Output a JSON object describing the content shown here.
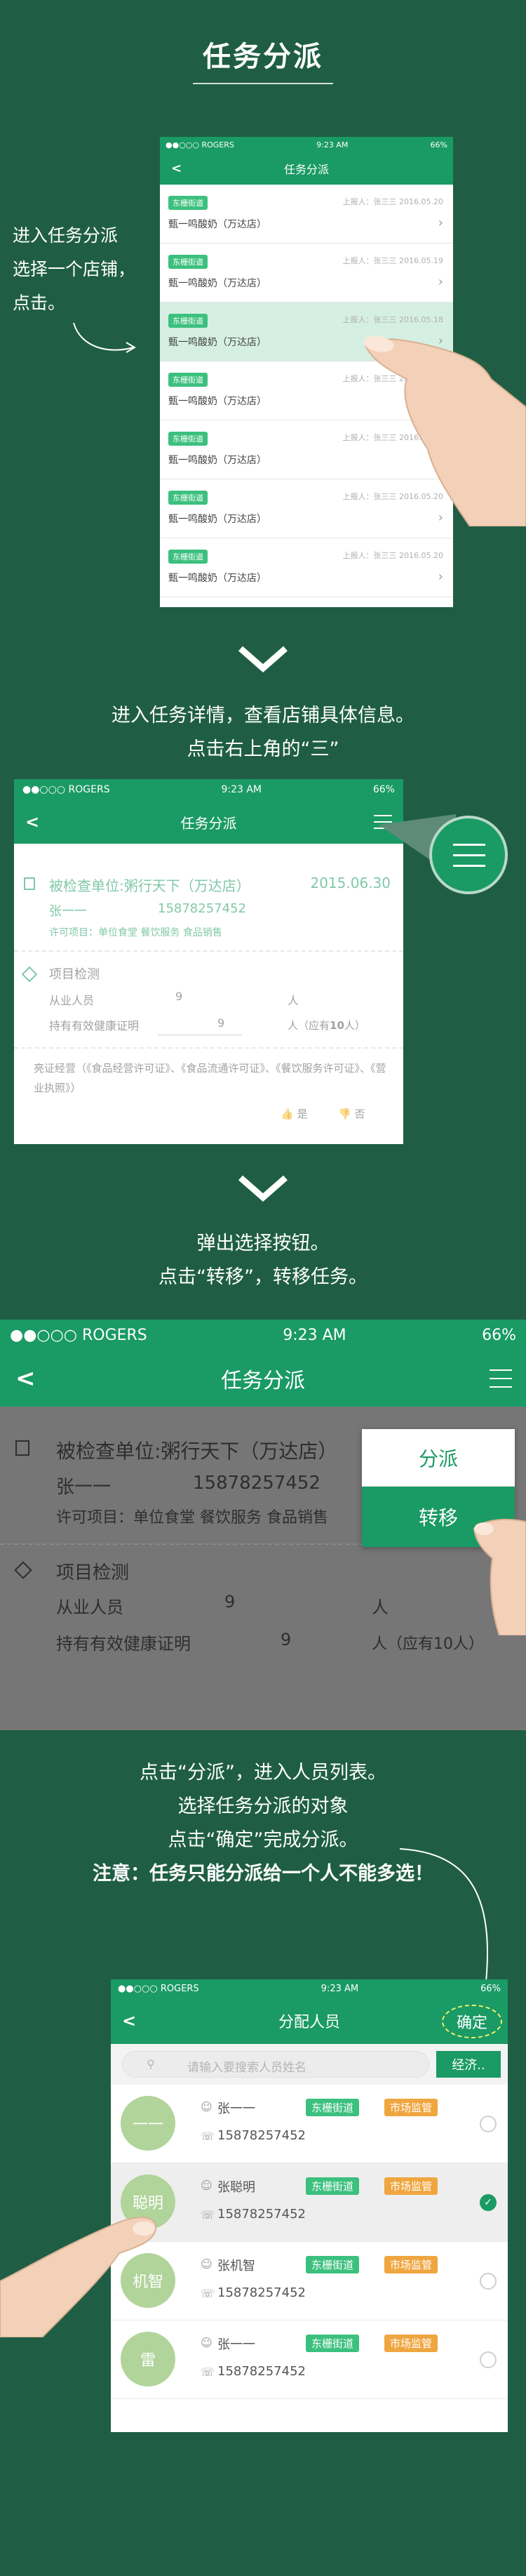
{
  "page_title": "任务分派",
  "step1": {
    "caption_lines": [
      "进入任务分派",
      "选择一个店铺，",
      "点击。"
    ],
    "phone": {
      "carrier": "●●○○○ ROGERS",
      "time": "9:23 AM",
      "battery": "66%",
      "title": "任务分派",
      "rows": [
        {
          "badge": "东栅街道",
          "meta": "上报人：张三三    2016.05.20",
          "shop": "甄一鸣酸奶（万达店）",
          "selected": false
        },
        {
          "badge": "东栅街道",
          "meta": "上报人：张三三    2016.05.19",
          "shop": "甄一鸣酸奶（万达店）",
          "selected": false
        },
        {
          "badge": "东栅街道",
          "meta": "上报人：张三三    2016.05.18",
          "shop": "甄一鸣酸奶（万达店）",
          "selected": true
        },
        {
          "badge": "东栅街道",
          "meta": "上报人：张三三    2016.05.20",
          "shop": "甄一鸣酸奶（万达店）",
          "selected": false
        },
        {
          "badge": "东栅街道",
          "meta": "上报人：张三三    2016.05.20",
          "shop": "甄一鸣酸奶（万达店）",
          "selected": false
        },
        {
          "badge": "东栅街道",
          "meta": "上报人：张三三    2016.05.20",
          "shop": "甄一鸣酸奶（万达店）",
          "selected": false
        },
        {
          "badge": "东栅街道",
          "meta": "上报人：张三三    2016.05.20",
          "shop": "甄一鸣酸奶（万达店）",
          "selected": false
        }
      ]
    }
  },
  "step2": {
    "caption_lines": [
      "进入任务详情，查看店铺具体信息。",
      "点击右上角的“三”"
    ],
    "phone": {
      "carrier": "●●○○○ ROGERS",
      "time": "9:23 AM",
      "battery": "66%",
      "title": "任务分派",
      "unit_label": "被检查单位:粥行天下（万达店）",
      "date": "2015.06.30",
      "person": "张一一",
      "phone": "15878257452",
      "permit": "许可项目：单位食堂  餐饮服务  食品销售",
      "section": "项目检测",
      "staff_label": "从业人员",
      "staff_count": "9",
      "staff_unit": "人",
      "health_label": "持有有效健康证明",
      "health_count": "9",
      "health_unit_prefix": "人（应有",
      "health_need": "10",
      "health_unit_suffix": "人）",
      "licenses": "亮证经营（《食品经营许可证》、《食品流通许可证》、《餐饮服务许可证》、《营业执照》）",
      "yes": "是",
      "no": "否"
    }
  },
  "step3": {
    "caption_lines": [
      "弹出选择按钮。",
      "点击“转移”，转移任务。"
    ],
    "phone": {
      "carrier": "●●○○○ ROGERS",
      "time": "9:23 AM",
      "battery": "66%",
      "title": "任务分派",
      "unit_label": "被检查单位:粥行天下（万达店）",
      "person": "张一一",
      "phone": "15878257452",
      "permit": "许可项目：单位食堂  餐饮服务  食品销售",
      "section": "项目检测",
      "staff_label": "从业人员",
      "staff_count": "9",
      "staff_unit": "人",
      "health_label": "持有有效健康证明",
      "health_count": "9",
      "health_unit": "人（应有10人）",
      "menu_assign": "分派",
      "menu_transfer": "转移"
    }
  },
  "step4": {
    "caption_lines": [
      "点击“分派”，进入人员列表。",
      "选择任务分派的对象",
      "点击“确定”完成分派。"
    ],
    "note": "注意：任务只能分派给一个人不能多选！",
    "phone": {
      "carrier": "●●○○○ ROGERS",
      "time": "9:23 AM",
      "battery": "66%",
      "title": "分配人员",
      "confirm": "确定",
      "search_placeholder": "请输入要搜索人员姓名",
      "filter": "经济..",
      "people": [
        {
          "avatar": "一一",
          "name": "张一一",
          "tag1": "东栅街道",
          "tag2": "市场监管",
          "phone": "15878257452",
          "checked": false
        },
        {
          "avatar": "聪明",
          "name": "张聪明",
          "tag1": "东栅街道",
          "tag2": "市场监管",
          "phone": "15878257452",
          "checked": true
        },
        {
          "avatar": "机智",
          "name": "张机智",
          "tag1": "东栅街道",
          "tag2": "市场监管",
          "phone": "15878257452",
          "checked": false
        },
        {
          "avatar": "雷",
          "name": "张一一",
          "tag1": "东栅街道",
          "tag2": "市场监管",
          "phone": "15878257452",
          "checked": false
        }
      ]
    }
  },
  "colors": {
    "background": "#1f5e45",
    "accent_green": "#1a9a64",
    "badge_green": "#3cc07e",
    "badge_orange": "#f0a640"
  }
}
